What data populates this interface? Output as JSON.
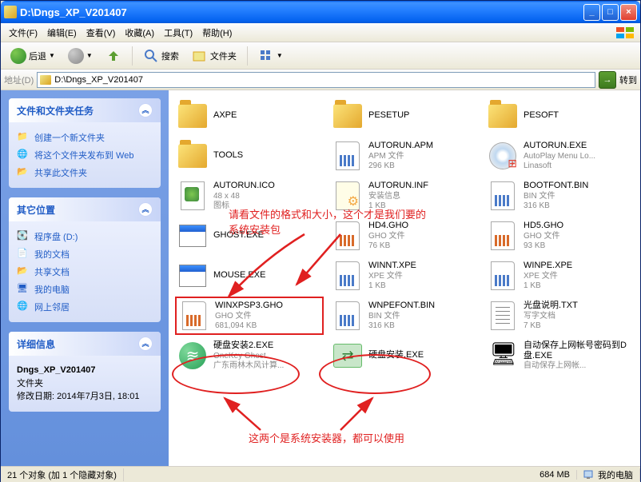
{
  "window": {
    "title": "D:\\Dngs_XP_V201407"
  },
  "menu": {
    "file": "文件(F)",
    "edit": "编辑(E)",
    "view": "查看(V)",
    "fav": "收藏(A)",
    "tools": "工具(T)",
    "help": "帮助(H)"
  },
  "toolbar": {
    "back": "后退",
    "search": "搜索",
    "folders": "文件夹"
  },
  "address": {
    "label": "地址(D)",
    "path": "D:\\Dngs_XP_V201407",
    "go": "转到"
  },
  "side": {
    "tasks": {
      "title": "文件和文件夹任务",
      "items": [
        {
          "label": "创建一个新文件夹"
        },
        {
          "label": "将这个文件夹发布到 Web"
        },
        {
          "label": "共享此文件夹"
        }
      ]
    },
    "other": {
      "title": "其它位置",
      "items": [
        {
          "label": "程序盘 (D:)"
        },
        {
          "label": "我的文档"
        },
        {
          "label": "共享文档"
        },
        {
          "label": "我的电脑"
        },
        {
          "label": "网上邻居"
        }
      ]
    },
    "details": {
      "title": "详细信息",
      "name": "Dngs_XP_V201407",
      "type": "文件夹",
      "modified": "修改日期: 2014年7月3日, 18:01"
    }
  },
  "files": [
    {
      "name": "AXPE",
      "type": "folder"
    },
    {
      "name": "PESETUP",
      "type": "folder"
    },
    {
      "name": "PESOFT",
      "type": "folder"
    },
    {
      "name": "TOOLS",
      "type": "folder"
    },
    {
      "name": "AUTORUN.APM",
      "meta1": "APM 文件",
      "meta2": "296 KB",
      "type": "apm"
    },
    {
      "name": "AUTORUN.EXE",
      "meta1": "AutoPlay Menu Lo...",
      "meta2": "Linasoft",
      "type": "cd"
    },
    {
      "name": "AUTORUN.ICO",
      "meta1": "48 x 48",
      "meta2": "图标",
      "type": "png"
    },
    {
      "name": "AUTORUN.INF",
      "meta1": "安装信息",
      "meta2": "1 KB",
      "type": "inf"
    },
    {
      "name": "BOOTFONT.BIN",
      "meta1": "BIN 文件",
      "meta2": "316 KB",
      "type": "bin"
    },
    {
      "name": "GHOST.EXE",
      "type": "exe"
    },
    {
      "name": "HD4.GHO",
      "meta1": "GHO 文件",
      "meta2": "76 KB",
      "type": "gho"
    },
    {
      "name": "HD5.GHO",
      "meta1": "GHO 文件",
      "meta2": "93 KB",
      "type": "gho"
    },
    {
      "name": "MOUSE.EXE",
      "type": "exe"
    },
    {
      "name": "WINNT.XPE",
      "meta1": "XPE 文件",
      "meta2": "1 KB",
      "type": "bin"
    },
    {
      "name": "WINPE.XPE",
      "meta1": "XPE 文件",
      "meta2": "1 KB",
      "type": "bin"
    },
    {
      "name": "WINXPSP3.GHO",
      "meta1": "GHO 文件",
      "meta2": "681,094 KB",
      "type": "gho",
      "boxed": true
    },
    {
      "name": "WNPEFONT.BIN",
      "meta1": "BIN 文件",
      "meta2": "316 KB",
      "type": "bin"
    },
    {
      "name": "光盘说明.TXT",
      "meta1": "写字文档",
      "meta2": "7 KB",
      "type": "txt"
    },
    {
      "name": "硬盘安装2.EXE",
      "meta1": "OneKey Ghost",
      "meta2": "广东雨林木风计算...",
      "type": "green"
    },
    {
      "name": "硬盘安装.EXE",
      "type": "green2"
    },
    {
      "name": "自动保存上网帐号密码到D盘.EXE",
      "meta1": "自动保存上网帐...",
      "type": "pc"
    }
  ],
  "annotations": {
    "a1": "请看文件的格式和大小，这个才是我们要的\n系统安装包",
    "a2": "这两个是系统安装器，都可以使用"
  },
  "status": {
    "objects": "21 个对象 (加 1 个隐藏对象)",
    "size": "684 MB",
    "location": "我的电脑"
  }
}
